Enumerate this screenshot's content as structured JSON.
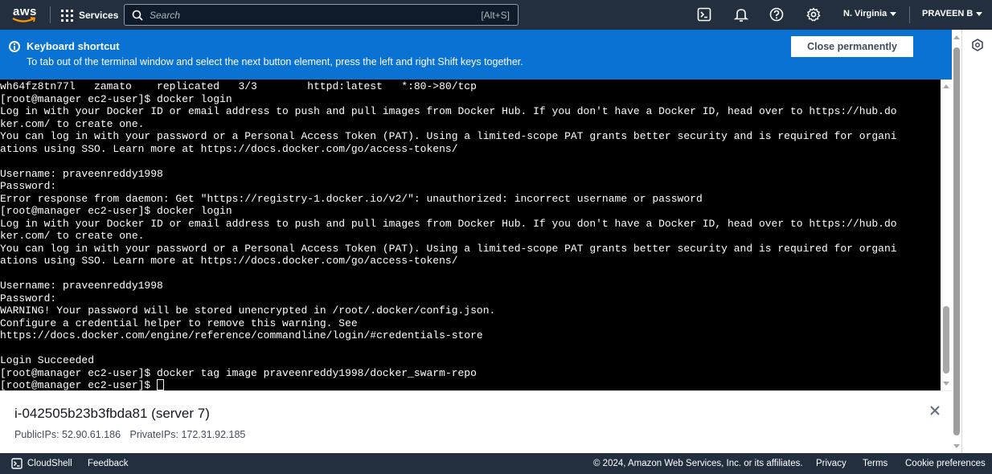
{
  "nav": {
    "logo": "aws",
    "services": "Services",
    "search_placeholder": "Search",
    "search_shortcut": "[Alt+S]",
    "region": "N. Virginia",
    "user": "PRAVEEN B",
    "icons": [
      "cloudshell-icon",
      "bell-icon",
      "help-icon",
      "settings-icon"
    ]
  },
  "banner": {
    "title": "Keyboard shortcut",
    "message": "To tab out of the terminal window and select the next button element, press the left and right Shift keys together.",
    "close_label": "Close permanently",
    "color": "#0972d3"
  },
  "terminal": {
    "lines": [
      "wh64fz8tn77l   zamato    replicated   3/3        httpd:latest   *:80->80/tcp",
      "[root@manager ec2-user]$ docker login",
      "Log in with your Docker ID or email address to push and pull images from Docker Hub. If you don't have a Docker ID, head over to https://hub.do",
      "ker.com/ to create one.",
      "You can log in with your password or a Personal Access Token (PAT). Using a limited-scope PAT grants better security and is required for organi",
      "ations using SSO. Learn more at https://docs.docker.com/go/access-tokens/",
      "",
      "Username: praveenreddy1998",
      "Password:",
      "Error response from daemon: Get \"https://registry-1.docker.io/v2/\": unauthorized: incorrect username or password",
      "[root@manager ec2-user]$ docker login",
      "Log in with your Docker ID or email address to push and pull images from Docker Hub. If you don't have a Docker ID, head over to https://hub.do",
      "ker.com/ to create one.",
      "You can log in with your password or a Personal Access Token (PAT). Using a limited-scope PAT grants better security and is required for organi",
      "ations using SSO. Learn more at https://docs.docker.com/go/access-tokens/",
      "",
      "Username: praveenreddy1998",
      "Password:",
      "WARNING! Your password will be stored unencrypted in /root/.docker/config.json.",
      "Configure a credential helper to remove this warning. See",
      "https://docs.docker.com/engine/reference/commandline/login/#credentials-store",
      "",
      "Login Succeeded",
      "[root@manager ec2-user]$ docker tag image praveenreddy1998/docker_swarm-repo"
    ],
    "prompt": "[root@manager ec2-user]$ "
  },
  "instance": {
    "title": "i-042505b23b3fbda81 (server 7)",
    "public_ips": "PublicIPs: 52.90.61.186",
    "private_ips": "PrivateIPs: 172.31.92.185"
  },
  "footer": {
    "cloudshell": "CloudShell",
    "feedback": "Feedback",
    "copyright": "© 2024, Amazon Web Services, Inc. or its affiliates.",
    "privacy": "Privacy",
    "terms": "Terms",
    "cookies": "Cookie preferences"
  }
}
